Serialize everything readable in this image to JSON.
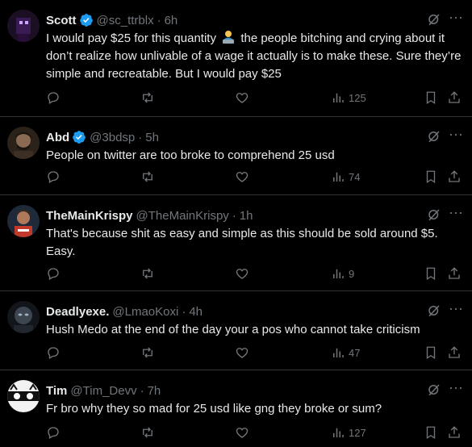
{
  "tweets": [
    {
      "name": "Scott",
      "verified": true,
      "handle": "@sc_ttrblx",
      "time": "6h",
      "text_before": "I would pay $25 for this quantity",
      "emoji": "person-at-laptop",
      "text_after": " the people bitching and crying about it don’t realize how unlivable of a wage it actually is to make these. Sure they’re simple and recreatable. But I would pay $25",
      "views": "125"
    },
    {
      "name": "Abd",
      "verified": true,
      "handle": "@3bdsp",
      "time": "5h",
      "text": "People on twitter are too broke to comprehend 25 usd",
      "views": "74"
    },
    {
      "name": "TheMainKrispy",
      "verified": false,
      "handle": "@TheMainKrispy",
      "time": "1h",
      "text": "That's because shit as easy and simple as this should be sold around $5. Easy.",
      "views": "9"
    },
    {
      "name": "Deadlyexe.",
      "verified": false,
      "handle": "@LmaoKoxi",
      "time": "4h",
      "text": "Hush Medo at the end of the day your a pos who cannot take criticism",
      "views": "47"
    },
    {
      "name": "Tim",
      "verified": false,
      "handle": "@Tim_Devv",
      "time": "7h",
      "text": "Fr bro why they so mad for 25 usd like gng they broke or sum?",
      "views": "127"
    }
  ],
  "icons": {
    "verified": "verified-badge-icon",
    "grok": "grok-icon",
    "more": "more-icon",
    "reply": "reply-icon",
    "repost": "repost-icon",
    "like": "like-icon",
    "views": "views-icon",
    "bookmark": "bookmark-icon",
    "share": "share-icon"
  },
  "colors": {
    "background": "#000000",
    "text": "#e7e9ea",
    "muted": "#71767b",
    "divider": "#2f3336",
    "verified": "#1d9bf0"
  },
  "separator": "·",
  "more_glyph": "···"
}
